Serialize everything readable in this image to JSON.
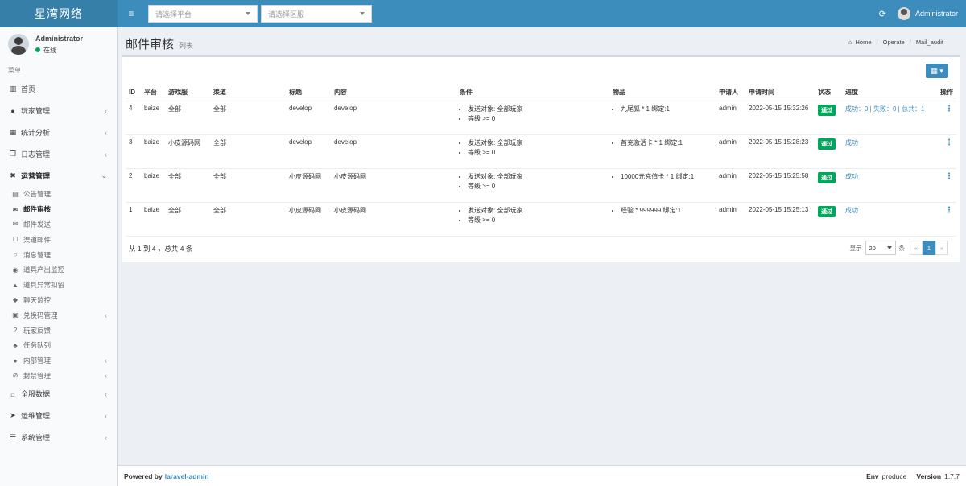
{
  "header": {
    "logo": "星湾网络",
    "toggle_icon": "≡",
    "platform_placeholder": "请选择平台",
    "region_placeholder": "请选择区服",
    "user": "Administrator"
  },
  "sidebar": {
    "user_name": "Administrator",
    "status": "在线",
    "menu_header": "菜单",
    "top_items": [
      {
        "label": "首页"
      },
      {
        "label": "玩家管理"
      },
      {
        "label": "统计分析"
      },
      {
        "label": "日志管理"
      },
      {
        "label": "运营管理"
      }
    ],
    "sub_items": [
      {
        "label": "公告管理"
      },
      {
        "label": "邮件审核"
      },
      {
        "label": "邮件发送"
      },
      {
        "label": "渠道邮件"
      },
      {
        "label": "消息管理"
      },
      {
        "label": "道具产出监控"
      },
      {
        "label": "道具异常扣留"
      },
      {
        "label": "聊天监控"
      },
      {
        "label": "兑换码管理"
      },
      {
        "label": "玩家反馈"
      },
      {
        "label": "任务队列"
      },
      {
        "label": "内部管理"
      },
      {
        "label": "封禁管理"
      }
    ],
    "bottom_items": [
      {
        "label": "全服数据"
      },
      {
        "label": "运维管理"
      },
      {
        "label": "系统管理"
      }
    ]
  },
  "content": {
    "title": "邮件审核",
    "subtitle": "列表",
    "breadcrumb": [
      "Home",
      "Operate",
      "Mail_audit"
    ]
  },
  "table": {
    "headers": [
      "ID",
      "平台",
      "游戏服",
      "渠道",
      "标题",
      "内容",
      "条件",
      "物品",
      "申请人",
      "申请时间",
      "状态",
      "进度",
      "操作"
    ],
    "rows": [
      {
        "id": "4",
        "platform": "baize",
        "server": "全部",
        "channel": "全部",
        "title": "develop",
        "content": "develop",
        "cond1": "发送对象: 全部玩家",
        "cond2": "等级 >= 0",
        "item": "九尾狐 * 1 绑定:1",
        "applicant": "admin",
        "time": "2022-05-15 15:32:26",
        "status": "通过",
        "progress": "成功：0 | 失败：0 | 总共：1"
      },
      {
        "id": "3",
        "platform": "baize",
        "server": "小皮源码网",
        "channel": "全部",
        "title": "develop",
        "content": "develop",
        "cond1": "发送对象: 全部玩家",
        "cond2": "等级 >= 0",
        "item": "首充激活卡 * 1 绑定:1",
        "applicant": "admin",
        "time": "2022-05-15 15:28:23",
        "status": "通过",
        "progress": "成功"
      },
      {
        "id": "2",
        "platform": "baize",
        "server": "全部",
        "channel": "全部",
        "title": "小皮源码网",
        "content": "小皮源码网",
        "cond1": "发送对象: 全部玩家",
        "cond2": "等级 >= 0",
        "item": "10000元充值卡 * 1 绑定:1",
        "applicant": "admin",
        "time": "2022-05-15 15:25:58",
        "status": "通过",
        "progress": "成功"
      },
      {
        "id": "1",
        "platform": "baize",
        "server": "全部",
        "channel": "全部",
        "title": "小皮源码网",
        "content": "小皮源码网",
        "cond1": "发送对象: 全部玩家",
        "cond2": "等级 >= 0",
        "item": "经验 * 999999 绑定:1",
        "applicant": "admin",
        "time": "2022-05-15 15:25:13",
        "status": "通过",
        "progress": "成功"
      }
    ],
    "summary": "从 1 到 4 ，总共 4 条",
    "show_label": "显示",
    "per_page": "20",
    "unit_label": "条",
    "prev": "«",
    "page": "1",
    "next": "»"
  },
  "footer": {
    "powered": "Powered by",
    "brand": "laravel-admin",
    "env_label": "Env",
    "env_value": "produce",
    "version_label": "Version",
    "version_value": "1.7.7"
  }
}
